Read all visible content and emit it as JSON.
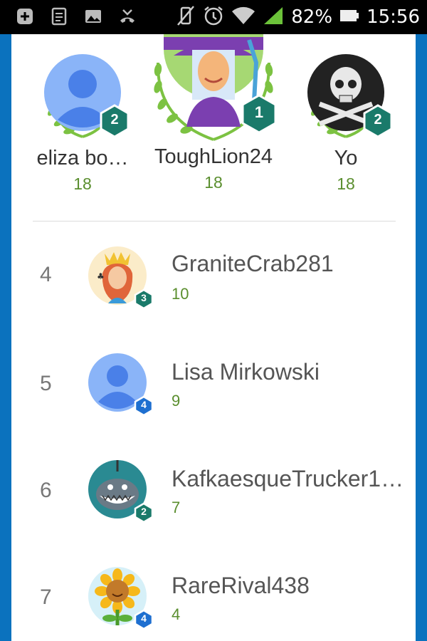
{
  "status_bar": {
    "battery_percent": "82%",
    "time": "15:56",
    "icons": [
      "notification-plus-icon",
      "notes-icon",
      "gallery-icon",
      "missed-call-icon",
      "vibrate-off-icon",
      "alarm-icon",
      "wifi-icon",
      "signal-icon",
      "battery-icon"
    ]
  },
  "podium": [
    {
      "name": "eliza bo…",
      "score": "18",
      "level": "2",
      "avatar": "default-person"
    },
    {
      "name": "ToughLion24",
      "score": "18",
      "level": "1",
      "avatar": "wizard"
    },
    {
      "name": "Yo",
      "score": "18",
      "level": "2",
      "avatar": "skull"
    }
  ],
  "list": [
    {
      "rank": "4",
      "name": "GraniteCrab281",
      "score": "10",
      "level": "3",
      "badge_color": "#1a7a6a",
      "avatar": "queen"
    },
    {
      "rank": "5",
      "name": "Lisa Mirkowski",
      "score": "9",
      "level": "4",
      "badge_color": "#1e6fd0",
      "avatar": "default-person"
    },
    {
      "rank": "6",
      "name": "KafkaesqueTrucker1…",
      "score": "7",
      "level": "2",
      "badge_color": "#1a7a6a",
      "avatar": "shark"
    },
    {
      "rank": "7",
      "name": "RareRival438",
      "score": "4",
      "level": "4",
      "badge_color": "#1e6fd0",
      "avatar": "sunflower"
    }
  ],
  "colors": {
    "accent": "#0b72be",
    "score_green": "#5a8e2e",
    "badge_teal": "#1a7a6a",
    "badge_blue": "#1e6fd0",
    "laurel": "#7cc242"
  }
}
